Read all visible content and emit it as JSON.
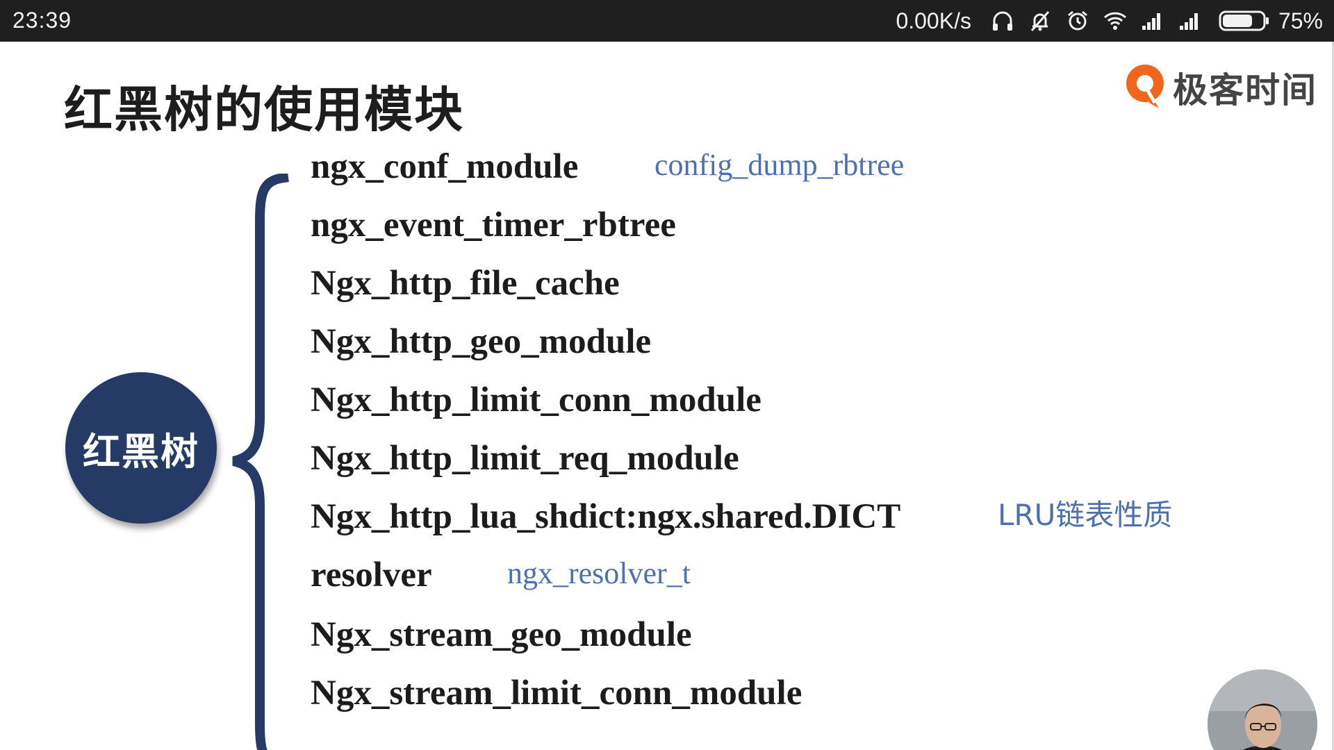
{
  "status_bar": {
    "time": "23:39",
    "network_speed": "0.00K/s",
    "battery_percent": "75%",
    "battery_level": 0.75,
    "icons": [
      "headphones-icon",
      "notifications-off-icon",
      "alarm-icon",
      "wifi-icon",
      "signal-icon",
      "signal-icon",
      "battery-icon"
    ]
  },
  "slide": {
    "title": "红黑树的使用模块",
    "logo_text": "极客时间",
    "center_node": "红黑树",
    "items": [
      {
        "label": "ngx_conf_module",
        "note": "config_dump_rbtree"
      },
      {
        "label": "ngx_event_timer_rbtree",
        "note": ""
      },
      {
        "label": "Ngx_http_file_cache",
        "note": ""
      },
      {
        "label": "Ngx_http_geo_module",
        "note": ""
      },
      {
        "label": "Ngx_http_limit_conn_module",
        "note": ""
      },
      {
        "label": "Ngx_http_limit_req_module",
        "note": ""
      },
      {
        "label": "Ngx_http_lua_shdict:ngx.shared.DICT",
        "note": "LRU链表性质"
      },
      {
        "label": "resolver",
        "note": "ngx_resolver_t"
      },
      {
        "label": "Ngx_stream_geo_module",
        "note": ""
      },
      {
        "label": "Ngx_stream_limit_conn_module",
        "note": ""
      }
    ]
  },
  "colors": {
    "status_bar_bg": "#1f1f1f",
    "node_fill": "#263a66",
    "brace": "#263a66",
    "note_text": "#4e6fb0",
    "logo_orange": "#f0661d"
  }
}
